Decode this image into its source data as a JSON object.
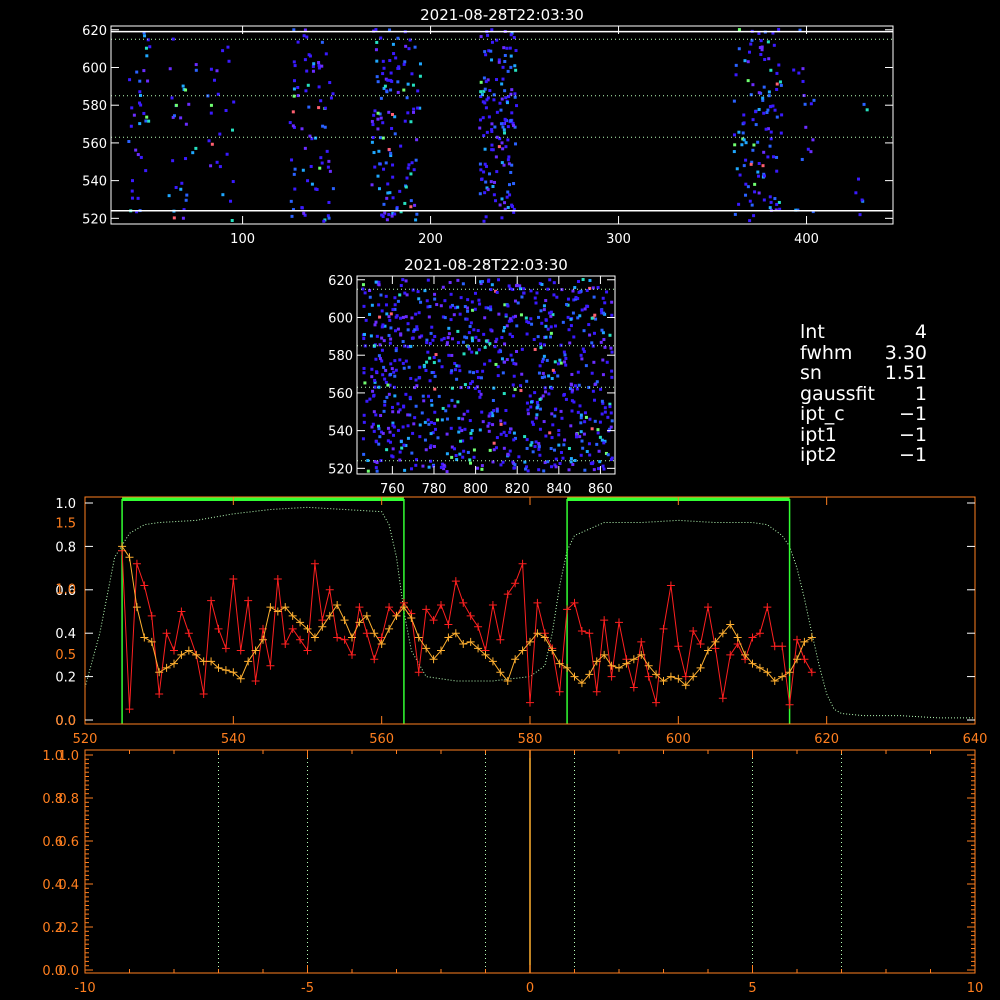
{
  "colors": {
    "background": "#000000",
    "axis_white": "#ffffff",
    "axis_orange": "#ff7f1f",
    "red_series": "#ff2020",
    "orange_series": "#ffb030",
    "green_bound": "#33ff33",
    "dotted_green": "#b8ffb8",
    "spot_palette": [
      "#3a1aff",
      "#6a2cff",
      "#2a62ff",
      "#1fa8ff",
      "#26e0c0",
      "#70ff70",
      "#ff6070",
      "#ffffff"
    ]
  },
  "info_panel": {
    "rows": [
      {
        "key": "lnt",
        "value": "4"
      },
      {
        "key": "fwhm",
        "value": "3.30"
      },
      {
        "key": "sn",
        "value": "1.51"
      },
      {
        "key": "gaussfit",
        "value": "1"
      },
      {
        "key": "ipt_c",
        "value": "−1"
      },
      {
        "key": "ipt1",
        "value": "−1"
      },
      {
        "key": "ipt2",
        "value": "−1"
      }
    ]
  },
  "chart_data": [
    {
      "type": "scatter",
      "id": "detector-full",
      "title": "2021-08-28T22:03:30",
      "xlim": [
        30,
        446
      ],
      "ylim": [
        517,
        622
      ],
      "x_ticks": [
        100,
        200,
        300,
        400
      ],
      "y_ticks": [
        520,
        540,
        560,
        580,
        600,
        620
      ],
      "hlines_solid": [
        524,
        619
      ],
      "hlines_dotted": [
        563,
        585,
        615
      ],
      "spot_columns": [
        {
          "x0": 38,
          "x1": 50,
          "density": 0.9
        },
        {
          "x0": 60,
          "x1": 75,
          "density": 0.6
        },
        {
          "x0": 80,
          "x1": 95,
          "density": 0.5
        },
        {
          "x0": 124,
          "x1": 148,
          "density": 1.0
        },
        {
          "x0": 168,
          "x1": 194,
          "density": 1.5
        },
        {
          "x0": 225,
          "x1": 245,
          "density": 2.3
        },
        {
          "x0": 360,
          "x1": 386,
          "density": 1.4
        },
        {
          "x0": 392,
          "x1": 405,
          "density": 0.4
        },
        {
          "x0": 425,
          "x1": 432,
          "density": 0.3
        }
      ]
    },
    {
      "type": "scatter",
      "id": "detector-zoom",
      "title": "2021-08-28T22:03:30",
      "xlim": [
        743,
        867
      ],
      "ylim": [
        517,
        622
      ],
      "x_ticks": [
        760,
        780,
        800,
        820,
        840,
        860
      ],
      "y_ticks": [
        520,
        540,
        560,
        580,
        600,
        620
      ],
      "hlines_dotted": [
        524,
        563,
        585,
        615
      ],
      "spot_columns": [
        {
          "x0": 745,
          "x1": 865,
          "density": 2.2
        }
      ]
    },
    {
      "type": "line",
      "id": "spectrum",
      "xlim": [
        520,
        640
      ],
      "x_ticks": [
        520,
        540,
        560,
        580,
        600,
        620,
        640
      ],
      "y_left_orange_ticks": [
        0.0,
        0.5,
        1.0,
        1.5
      ],
      "y_left_white_ticks": [
        0.0,
        0.2,
        0.4,
        0.6,
        0.8,
        1.0
      ],
      "ylim_white": [
        0,
        1.0
      ],
      "window_bounds": [
        [
          525,
          563
        ],
        [
          585,
          615
        ]
      ],
      "red_series": {
        "x_start": 525,
        "x_step": 1,
        "values": [
          0.78,
          0.05,
          0.72,
          0.62,
          0.48,
          0.12,
          0.4,
          0.32,
          0.5,
          0.4,
          0.3,
          0.12,
          0.55,
          0.42,
          0.33,
          0.65,
          0.32,
          0.55,
          0.18,
          0.42,
          0.25,
          0.65,
          0.35,
          0.42,
          0.37,
          0.32,
          0.72,
          0.46,
          0.6,
          0.38,
          0.37,
          0.3,
          0.52,
          0.4,
          0.28,
          0.38,
          0.52,
          0.48,
          0.54,
          0.49,
          0.22,
          0.51,
          0.46,
          0.53,
          0.44,
          0.64,
          0.54,
          0.48,
          0.43,
          0.32,
          0.53,
          0.37,
          0.58,
          0.63,
          0.72,
          0.08,
          0.54,
          0.4,
          0.33,
          0.13,
          0.51,
          0.54,
          0.41,
          0.4,
          0.13,
          0.46,
          0.2,
          0.45,
          0.28,
          0.15,
          0.36,
          0.2,
          0.08,
          0.42,
          0.62,
          0.34,
          0.2,
          0.41,
          0.35,
          0.52,
          0.33,
          0.1,
          0.3,
          0.35,
          0.28,
          0.38,
          0.4,
          0.52,
          0.34,
          0.34,
          0.07,
          0.37,
          0.28,
          0.22
        ]
      },
      "orange_series": {
        "x_start": 525,
        "x_step": 1,
        "values": [
          0.8,
          0.75,
          0.52,
          0.38,
          0.36,
          0.22,
          0.24,
          0.26,
          0.3,
          0.32,
          0.3,
          0.27,
          0.27,
          0.24,
          0.23,
          0.22,
          0.19,
          0.27,
          0.32,
          0.37,
          0.52,
          0.5,
          0.52,
          0.48,
          0.45,
          0.42,
          0.38,
          0.43,
          0.48,
          0.53,
          0.46,
          0.38,
          0.45,
          0.48,
          0.4,
          0.35,
          0.42,
          0.48,
          0.52,
          0.47,
          0.38,
          0.33,
          0.28,
          0.32,
          0.38,
          0.4,
          0.35,
          0.36,
          0.33,
          0.3,
          0.27,
          0.22,
          0.18,
          0.28,
          0.32,
          0.36,
          0.4,
          0.38,
          0.32,
          0.26,
          0.24,
          0.2,
          0.17,
          0.21,
          0.27,
          0.3,
          0.25,
          0.24,
          0.26,
          0.28,
          0.3,
          0.25,
          0.21,
          0.18,
          0.2,
          0.19,
          0.16,
          0.2,
          0.24,
          0.32,
          0.36,
          0.4,
          0.44,
          0.38,
          0.3,
          0.26,
          0.24,
          0.22,
          0.18,
          0.2,
          0.22,
          0.28,
          0.36,
          0.38
        ]
      },
      "dotted_profile": {
        "x": [
          520,
          522,
          524,
          526,
          528,
          530,
          535,
          540,
          545,
          550,
          555,
          560,
          561,
          562,
          563,
          564,
          566,
          570,
          575,
          580,
          582,
          583,
          584,
          585,
          586,
          588,
          590,
          595,
          600,
          605,
          610,
          612,
          614,
          615,
          616,
          617,
          618,
          619,
          620,
          621,
          622,
          625,
          630,
          635,
          640
        ],
        "y": [
          0.15,
          0.4,
          0.75,
          0.86,
          0.9,
          0.91,
          0.92,
          0.95,
          0.97,
          0.98,
          0.97,
          0.96,
          0.9,
          0.75,
          0.5,
          0.32,
          0.2,
          0.18,
          0.18,
          0.2,
          0.25,
          0.4,
          0.62,
          0.78,
          0.85,
          0.88,
          0.91,
          0.91,
          0.92,
          0.91,
          0.91,
          0.9,
          0.85,
          0.8,
          0.7,
          0.56,
          0.4,
          0.25,
          0.12,
          0.05,
          0.03,
          0.02,
          0.02,
          0.01,
          0.01
        ]
      }
    },
    {
      "type": "line",
      "id": "offset-panel",
      "xlim": [
        -10,
        10
      ],
      "x_ticks": [
        -10,
        -5,
        0,
        5,
        10
      ],
      "y_ticks_orange": [
        0.0,
        0.2,
        0.4,
        0.6,
        0.8,
        1.0
      ],
      "y_tick_labels": [
        "0.0",
        "0.2",
        "0.4",
        "0.6",
        "0.8",
        "1.0"
      ],
      "y_tick_labels_overlap": [
        "0.0",
        "0.2",
        "0.4",
        "0.6",
        "0.8",
        "1.0"
      ],
      "vlines_dotted": [
        -7,
        -5,
        -1,
        1,
        5,
        7
      ],
      "vline_solid": [
        0
      ]
    }
  ]
}
